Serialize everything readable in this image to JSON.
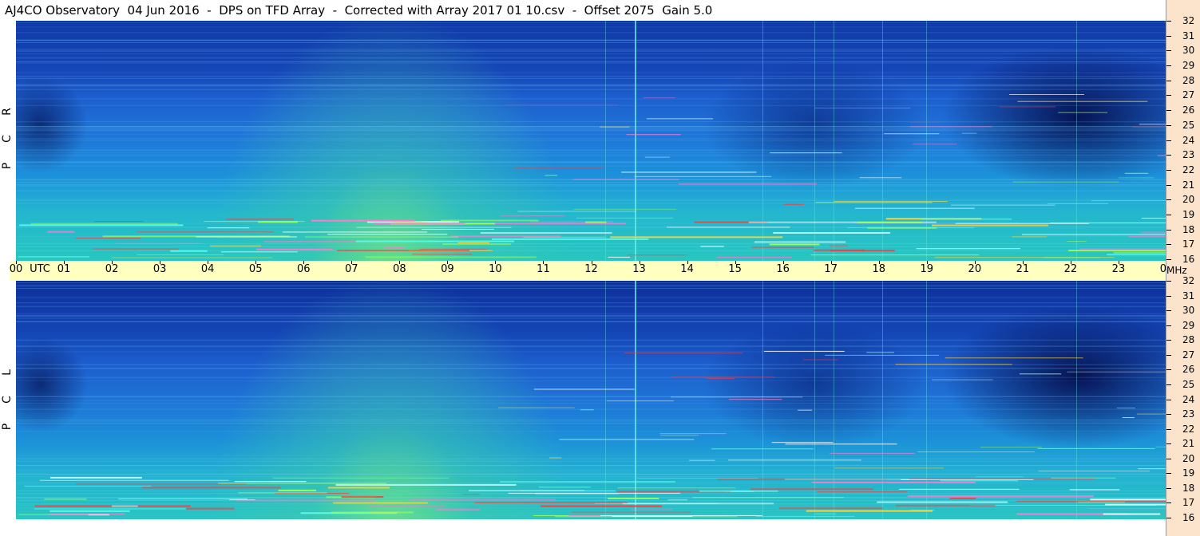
{
  "title": "AJ4CO Observatory  04 Jun 2016  -  DPS on TFD Array  -  Corrected with Array 2017 01 10.csv  -  Offset 2075  Gain 5.0",
  "colors": {
    "time_bar_bg": "#ffffc0",
    "freq_axis_bg": "#fce4cc"
  },
  "chart_data": [
    {
      "type": "heatmap",
      "panel": "RCP",
      "polarization_label": [
        "R",
        "C",
        "P"
      ],
      "x_axis": {
        "unit_label": "UTC",
        "range_hours": [
          0,
          24
        ],
        "ticks": [
          "00",
          "01",
          "02",
          "03",
          "04",
          "05",
          "06",
          "07",
          "08",
          "09",
          "10",
          "11",
          "12",
          "13",
          "14",
          "15",
          "16",
          "17",
          "18",
          "19",
          "20",
          "21",
          "22",
          "23",
          "00"
        ]
      },
      "y_axis": {
        "unit_label": "MHz",
        "range": [
          16,
          32
        ],
        "ticks": [
          "16",
          "17",
          "18",
          "19",
          "20",
          "21",
          "22",
          "23",
          "24",
          "25",
          "26",
          "27",
          "28",
          "29",
          "30",
          "31",
          "32"
        ]
      }
    },
    {
      "type": "heatmap",
      "panel": "LCP",
      "polarization_label": [
        "L",
        "C",
        "P"
      ],
      "x_axis": {
        "range_hours": [
          0,
          24
        ]
      },
      "y_axis": {
        "unit_label": "MHz",
        "range": [
          16,
          32
        ],
        "ticks": [
          "16",
          "17",
          "18",
          "19",
          "20",
          "21",
          "22",
          "23",
          "24",
          "25",
          "26",
          "27",
          "28",
          "29",
          "30",
          "31",
          "32"
        ]
      }
    }
  ]
}
